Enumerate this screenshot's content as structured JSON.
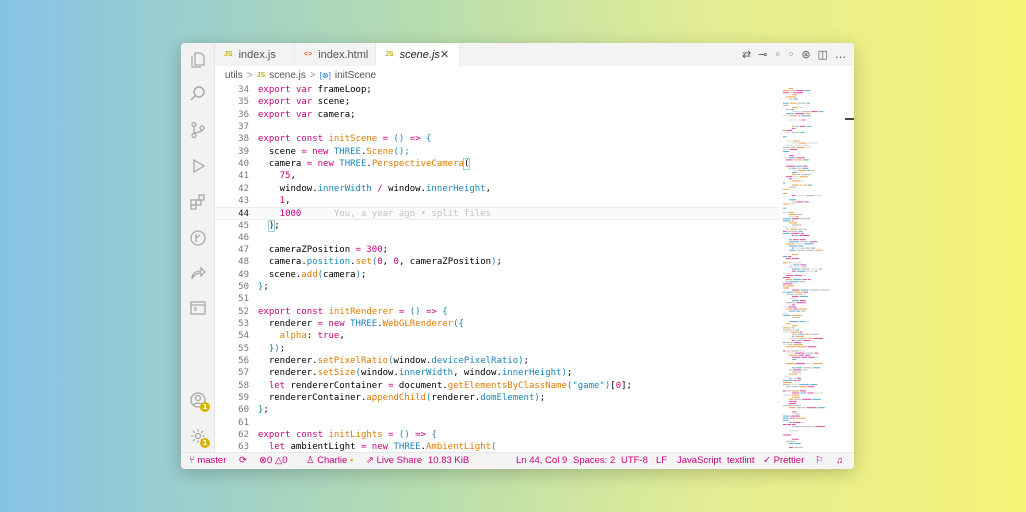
{
  "tabs": [
    {
      "icon": "JS",
      "label": "index.js",
      "active": false
    },
    {
      "icon": "<>",
      "label": "index.html",
      "active": false
    },
    {
      "icon": "JS",
      "label": "scene.js",
      "active": true,
      "close": "✕"
    }
  ],
  "breadcrumb": {
    "folder": "utils",
    "sep": ">",
    "file_icon": "JS",
    "file": "scene.js",
    "symbol_icon": "[⊗]",
    "symbol": "initScene"
  },
  "code_lines": [
    {
      "n": "34",
      "tokens": [
        [
          "kw",
          "export "
        ],
        [
          "kw",
          "var "
        ],
        [
          "",
          "frameLoop;"
        ]
      ]
    },
    {
      "n": "35",
      "tokens": [
        [
          "kw",
          "export "
        ],
        [
          "kw",
          "var "
        ],
        [
          "",
          "scene;"
        ]
      ]
    },
    {
      "n": "36",
      "tokens": [
        [
          "kw",
          "export "
        ],
        [
          "kw",
          "var "
        ],
        [
          "",
          "camera;"
        ]
      ]
    },
    {
      "n": "37",
      "tokens": []
    },
    {
      "n": "38",
      "tokens": [
        [
          "kw",
          "export "
        ],
        [
          "kw",
          "const "
        ],
        [
          "fn",
          "initScene "
        ],
        [
          "kw",
          "= "
        ],
        [
          "punc",
          "() "
        ],
        [
          "kw",
          "=> "
        ],
        [
          "punc",
          "{"
        ]
      ]
    },
    {
      "n": "39",
      "tokens": [
        [
          "",
          "  scene "
        ],
        [
          "kw",
          "= new "
        ],
        [
          "cls",
          "THREE"
        ],
        [
          "",
          "."
        ],
        [
          "fn",
          "Scene"
        ],
        [
          "punc",
          "();"
        ]
      ]
    },
    {
      "n": "40",
      "tokens": [
        [
          "",
          "  camera "
        ],
        [
          "kw",
          "= new "
        ],
        [
          "cls",
          "THREE"
        ],
        [
          "",
          "."
        ],
        [
          "fn",
          "PerspectiveCamera"
        ],
        [
          "bm",
          "("
        ]
      ]
    },
    {
      "n": "41",
      "tokens": [
        [
          "num",
          "    75"
        ],
        [
          "",
          ","
        ]
      ]
    },
    {
      "n": "42",
      "tokens": [
        [
          "",
          "    window."
        ],
        [
          "pl",
          "innerWidth "
        ],
        [
          "kw",
          "/ "
        ],
        [
          "",
          "window."
        ],
        [
          "pl",
          "innerHeight"
        ],
        [
          "",
          ","
        ]
      ]
    },
    {
      "n": "43",
      "tokens": [
        [
          "num",
          "    1"
        ],
        [
          "",
          ","
        ]
      ]
    },
    {
      "n": "44",
      "tokens": [
        [
          "num",
          "    1000"
        ],
        [
          "blame",
          "      You, a year ago • split files"
        ]
      ],
      "current": true
    },
    {
      "n": "45",
      "tokens": [
        [
          "",
          "  "
        ],
        [
          "bm",
          ")"
        ],
        [
          "",
          ";"
        ]
      ]
    },
    {
      "n": "46",
      "tokens": []
    },
    {
      "n": "47",
      "tokens": [
        [
          "",
          "  cameraZPosition "
        ],
        [
          "kw",
          "= "
        ],
        [
          "num",
          "300"
        ],
        [
          "",
          ";"
        ]
      ]
    },
    {
      "n": "48",
      "tokens": [
        [
          "",
          "  camera."
        ],
        [
          "pl",
          "position"
        ],
        [
          "",
          "."
        ],
        [
          "fn",
          "set"
        ],
        [
          "punc",
          "("
        ],
        [
          "num",
          "0"
        ],
        [
          "",
          ", "
        ],
        [
          "num",
          "0"
        ],
        [
          "",
          ", cameraZPosition"
        ],
        [
          "punc",
          ")"
        ],
        [
          "",
          ";"
        ]
      ]
    },
    {
      "n": "49",
      "tokens": [
        [
          "",
          "  scene."
        ],
        [
          "fn",
          "add"
        ],
        [
          "punc",
          "("
        ],
        [
          "",
          "camera"
        ],
        [
          "punc",
          ")"
        ],
        [
          "",
          ";"
        ]
      ]
    },
    {
      "n": "50",
      "tokens": [
        [
          "punc",
          "}"
        ],
        [
          "",
          ";"
        ]
      ]
    },
    {
      "n": "51",
      "tokens": []
    },
    {
      "n": "52",
      "tokens": [
        [
          "kw",
          "export "
        ],
        [
          "kw",
          "const "
        ],
        [
          "fn",
          "initRenderer "
        ],
        [
          "kw",
          "= "
        ],
        [
          "punc",
          "() "
        ],
        [
          "kw",
          "=> "
        ],
        [
          "punc",
          "{"
        ]
      ]
    },
    {
      "n": "53",
      "tokens": [
        [
          "",
          "  renderer "
        ],
        [
          "kw",
          "= new "
        ],
        [
          "cls",
          "THREE"
        ],
        [
          "",
          "."
        ],
        [
          "fn",
          "WebGLRenderer"
        ],
        [
          "punc",
          "({"
        ]
      ]
    },
    {
      "n": "54",
      "tokens": [
        [
          "prop",
          "    alpha"
        ],
        [
          "",
          ": "
        ],
        [
          "kw",
          "true"
        ],
        [
          "",
          ","
        ]
      ]
    },
    {
      "n": "55",
      "tokens": [
        [
          "punc",
          "  })"
        ],
        [
          "",
          ";"
        ]
      ]
    },
    {
      "n": "56",
      "tokens": [
        [
          "",
          "  renderer."
        ],
        [
          "fn",
          "setPixelRatio"
        ],
        [
          "punc",
          "("
        ],
        [
          "",
          "window."
        ],
        [
          "pl",
          "devicePixelRatio"
        ],
        [
          "punc",
          ")"
        ],
        [
          "",
          ";"
        ]
      ]
    },
    {
      "n": "57",
      "tokens": [
        [
          "",
          "  renderer."
        ],
        [
          "fn",
          "setSize"
        ],
        [
          "punc",
          "("
        ],
        [
          "",
          "window."
        ],
        [
          "pl",
          "innerWidth"
        ],
        [
          "",
          ", window."
        ],
        [
          "pl",
          "innerHeight"
        ],
        [
          "punc",
          ")"
        ],
        [
          "",
          ";"
        ]
      ]
    },
    {
      "n": "58",
      "tokens": [
        [
          "kw",
          "  let "
        ],
        [
          "",
          "rendererContainer "
        ],
        [
          "kw",
          "= "
        ],
        [
          "",
          "document."
        ],
        [
          "fn",
          "getElementsByClassName"
        ],
        [
          "punc",
          "("
        ],
        [
          "str",
          "\"game\""
        ],
        [
          "punc",
          ")"
        ],
        [
          "",
          "["
        ],
        [
          "num",
          "0"
        ],
        [
          "",
          "];"
        ]
      ]
    },
    {
      "n": "59",
      "tokens": [
        [
          "",
          "  rendererContainer."
        ],
        [
          "fn",
          "appendChild"
        ],
        [
          "punc",
          "("
        ],
        [
          "",
          "renderer."
        ],
        [
          "pl",
          "domElement"
        ],
        [
          "punc",
          ")"
        ],
        [
          "",
          ";"
        ]
      ]
    },
    {
      "n": "60",
      "tokens": [
        [
          "punc",
          "}"
        ],
        [
          "",
          ";"
        ]
      ]
    },
    {
      "n": "61",
      "tokens": []
    },
    {
      "n": "62",
      "tokens": [
        [
          "kw",
          "export "
        ],
        [
          "kw",
          "const "
        ],
        [
          "fn",
          "initLights "
        ],
        [
          "kw",
          "= "
        ],
        [
          "punc",
          "() "
        ],
        [
          "kw",
          "=> "
        ],
        [
          "punc",
          "{"
        ]
      ]
    },
    {
      "n": "63",
      "tokens": [
        [
          "kw",
          "  let "
        ],
        [
          "",
          "ambientLight "
        ],
        [
          "kw",
          "= new "
        ],
        [
          "cls",
          "THREE"
        ],
        [
          "",
          "."
        ],
        [
          "fn",
          "AmbientLight"
        ],
        [
          "punc",
          "("
        ]
      ]
    }
  ],
  "status": {
    "branch": "master",
    "sync_icon": "⟳",
    "errors": "0",
    "warnings": "0",
    "user": "Charlie",
    "live_share": "Live Share",
    "file_size": "10.83 KiB",
    "position": "Ln 44, Col 9",
    "spaces": "Spaces: 2",
    "encoding": "UTF-8",
    "eol": "LF",
    "language": "JavaScript",
    "linter": "textlint",
    "formatter": "Prettier"
  },
  "badges": {
    "accounts": "1",
    "settings": "1"
  },
  "colors": {
    "accent": "#c8007c",
    "keyword": "#c8007c",
    "function": "#e07a00",
    "class": "#1a86b8",
    "js_icon": "#c9b100"
  }
}
